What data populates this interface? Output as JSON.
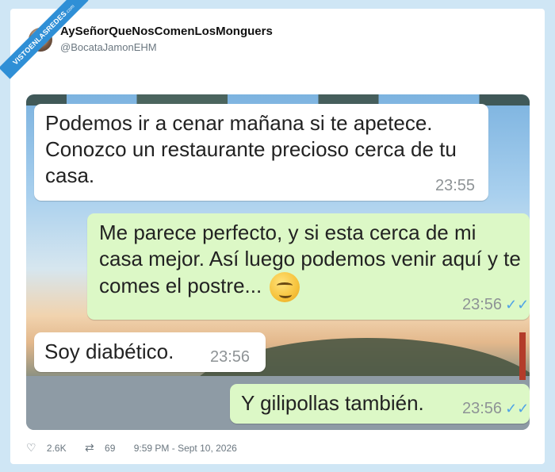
{
  "ribbon": {
    "main": "VISTOENLASREDES",
    "sub": ".com"
  },
  "tweet": {
    "user_name": "AySeñorQueNosComenLosMonguers",
    "handle": "@BocataJamonEHM"
  },
  "chat": {
    "messages": [
      {
        "direction": "incoming",
        "text": "Podemos ir a cenar mañana si te apetece. Conozco un restaurante precioso cerca de tu casa.",
        "time": "23:55"
      },
      {
        "direction": "outgoing",
        "text": "Me parece perfecto, y si esta cerca de mi casa mejor. Así luego podemos venir aquí y te comes el postre...",
        "emoji": "smirking-face",
        "time": "23:56"
      },
      {
        "direction": "incoming",
        "text": "Soy diabético.",
        "time": "23:56"
      },
      {
        "direction": "outgoing",
        "text": "Y gilipollas también.",
        "time": "23:56"
      }
    ]
  },
  "stats": {
    "likes": "2.6K",
    "retweets": "69",
    "timestamp": "9:59 PM - Sept 10, 2026"
  },
  "colors": {
    "incoming_bubble": "#ffffff",
    "outgoing_bubble": "#dcf8c6",
    "read_tick": "#4fa3e6",
    "ribbon": "#2f8fd6"
  }
}
